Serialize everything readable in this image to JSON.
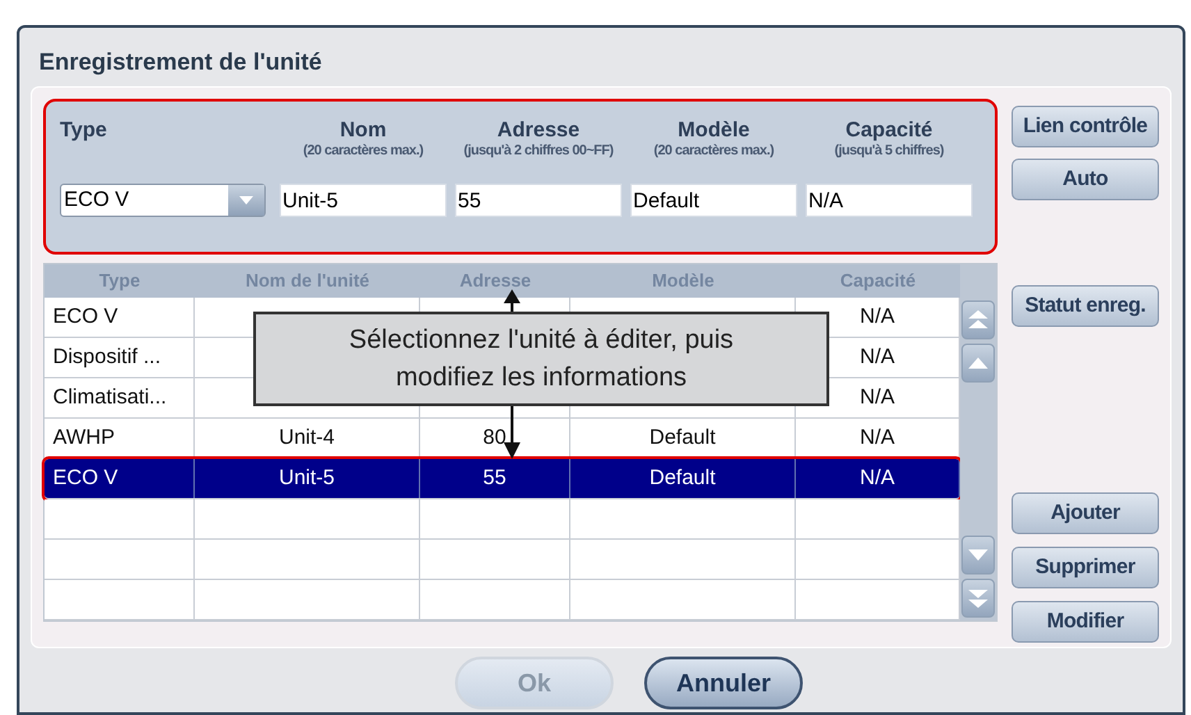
{
  "window": {
    "title": "Enregistrement de l'unité"
  },
  "form": {
    "type_label": "Type",
    "type_value": "ECO V",
    "fields": [
      {
        "label": "Nom",
        "hint": "(20 caractères max.)",
        "value": "Unit-5"
      },
      {
        "label": "Adresse",
        "hint": "(jusqu'à 2 chiffres 00~FF)",
        "value": "55"
      },
      {
        "label": "Modèle",
        "hint": "(20 caractères max.)",
        "value": "Default"
      },
      {
        "label": "Capacité",
        "hint": "(jusqu'à 5 chiffres)",
        "value": "N/A"
      }
    ]
  },
  "side_buttons_top": [
    "Lien contrôle",
    "Auto"
  ],
  "side_button_status": "Statut enreg.",
  "side_buttons_bottom": [
    "Ajouter",
    "Supprimer",
    "Modifier"
  ],
  "table": {
    "columns": [
      "Type",
      "Nom de l'unité",
      "Adresse",
      "Modèle",
      "Capacité"
    ],
    "rows": [
      {
        "cells": [
          "ECO V",
          "",
          "",
          "",
          "N/A"
        ],
        "selected": false
      },
      {
        "cells": [
          "Dispositif ...",
          "",
          "",
          "",
          "N/A"
        ],
        "selected": false
      },
      {
        "cells": [
          "Climatisati...",
          "",
          "",
          "",
          "N/A"
        ],
        "selected": false
      },
      {
        "cells": [
          "AWHP",
          "Unit-4",
          "80",
          "Default",
          "N/A"
        ],
        "selected": false
      },
      {
        "cells": [
          "ECO V",
          "Unit-5",
          "55",
          "Default",
          "N/A"
        ],
        "selected": true
      },
      {
        "cells": [
          "",
          "",
          "",
          "",
          ""
        ],
        "selected": false
      },
      {
        "cells": [
          "",
          "",
          "",
          "",
          ""
        ],
        "selected": false
      },
      {
        "cells": [
          "",
          "",
          "",
          "",
          ""
        ],
        "selected": false
      }
    ]
  },
  "callout": "Sélectionnez l'unité à éditer, puis modifiez les informations",
  "footer_buttons": [
    {
      "label": "Ok",
      "disabled": true
    },
    {
      "label": "Annuler",
      "disabled": false
    }
  ]
}
